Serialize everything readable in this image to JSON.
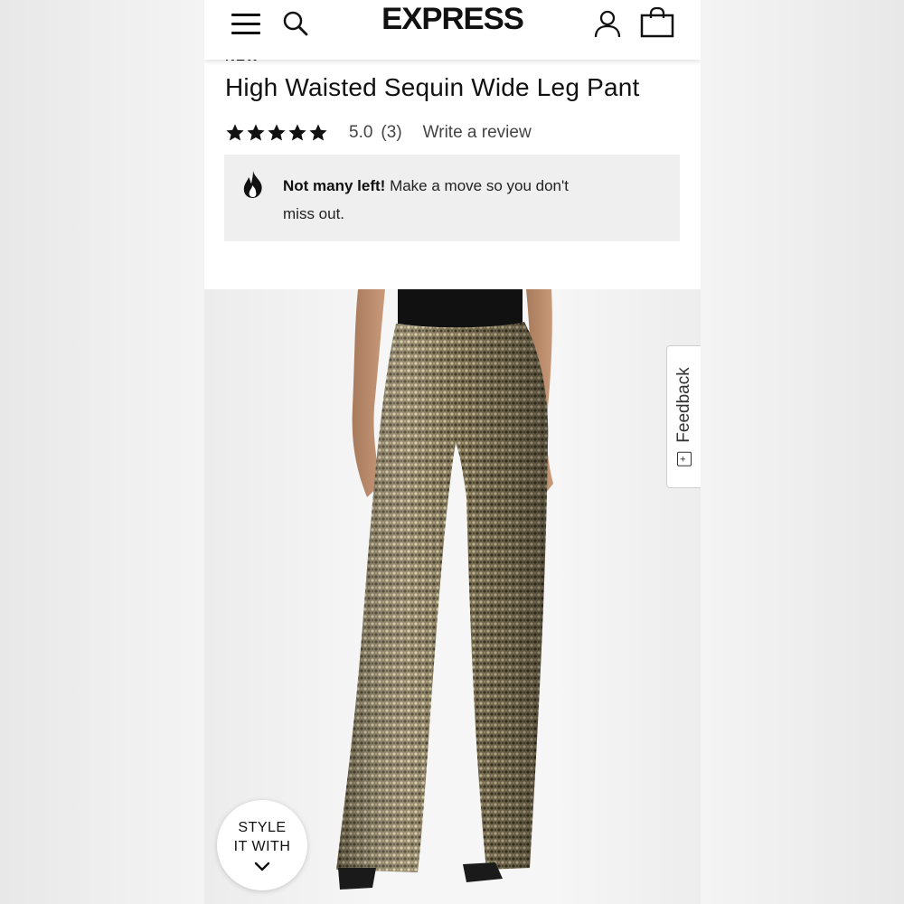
{
  "header": {
    "brand": "EXPRESS",
    "icons": [
      "menu-icon",
      "search-icon",
      "account-icon",
      "shopping-bag-icon"
    ]
  },
  "product": {
    "badge": "NEW",
    "title": "High Waisted Sequin Wide Leg Pant",
    "rating": {
      "stars": 5,
      "value": "5.0",
      "count": "(3)",
      "write_review_label": "Write a review"
    },
    "alert": {
      "icon": "fire-icon",
      "bold_text": "Not many left!",
      "text": " Make a move so you don't miss out."
    }
  },
  "feedback_tab": {
    "label": "Feedback",
    "icon_glyph": "+"
  },
  "style_it_with": {
    "line1": "STYLE",
    "line2": "IT WITH",
    "icon": "chevron-down-icon"
  },
  "colors": {
    "text": "#111111",
    "alert_bg": "#efefef",
    "sequin_gold": "#a89a72"
  }
}
